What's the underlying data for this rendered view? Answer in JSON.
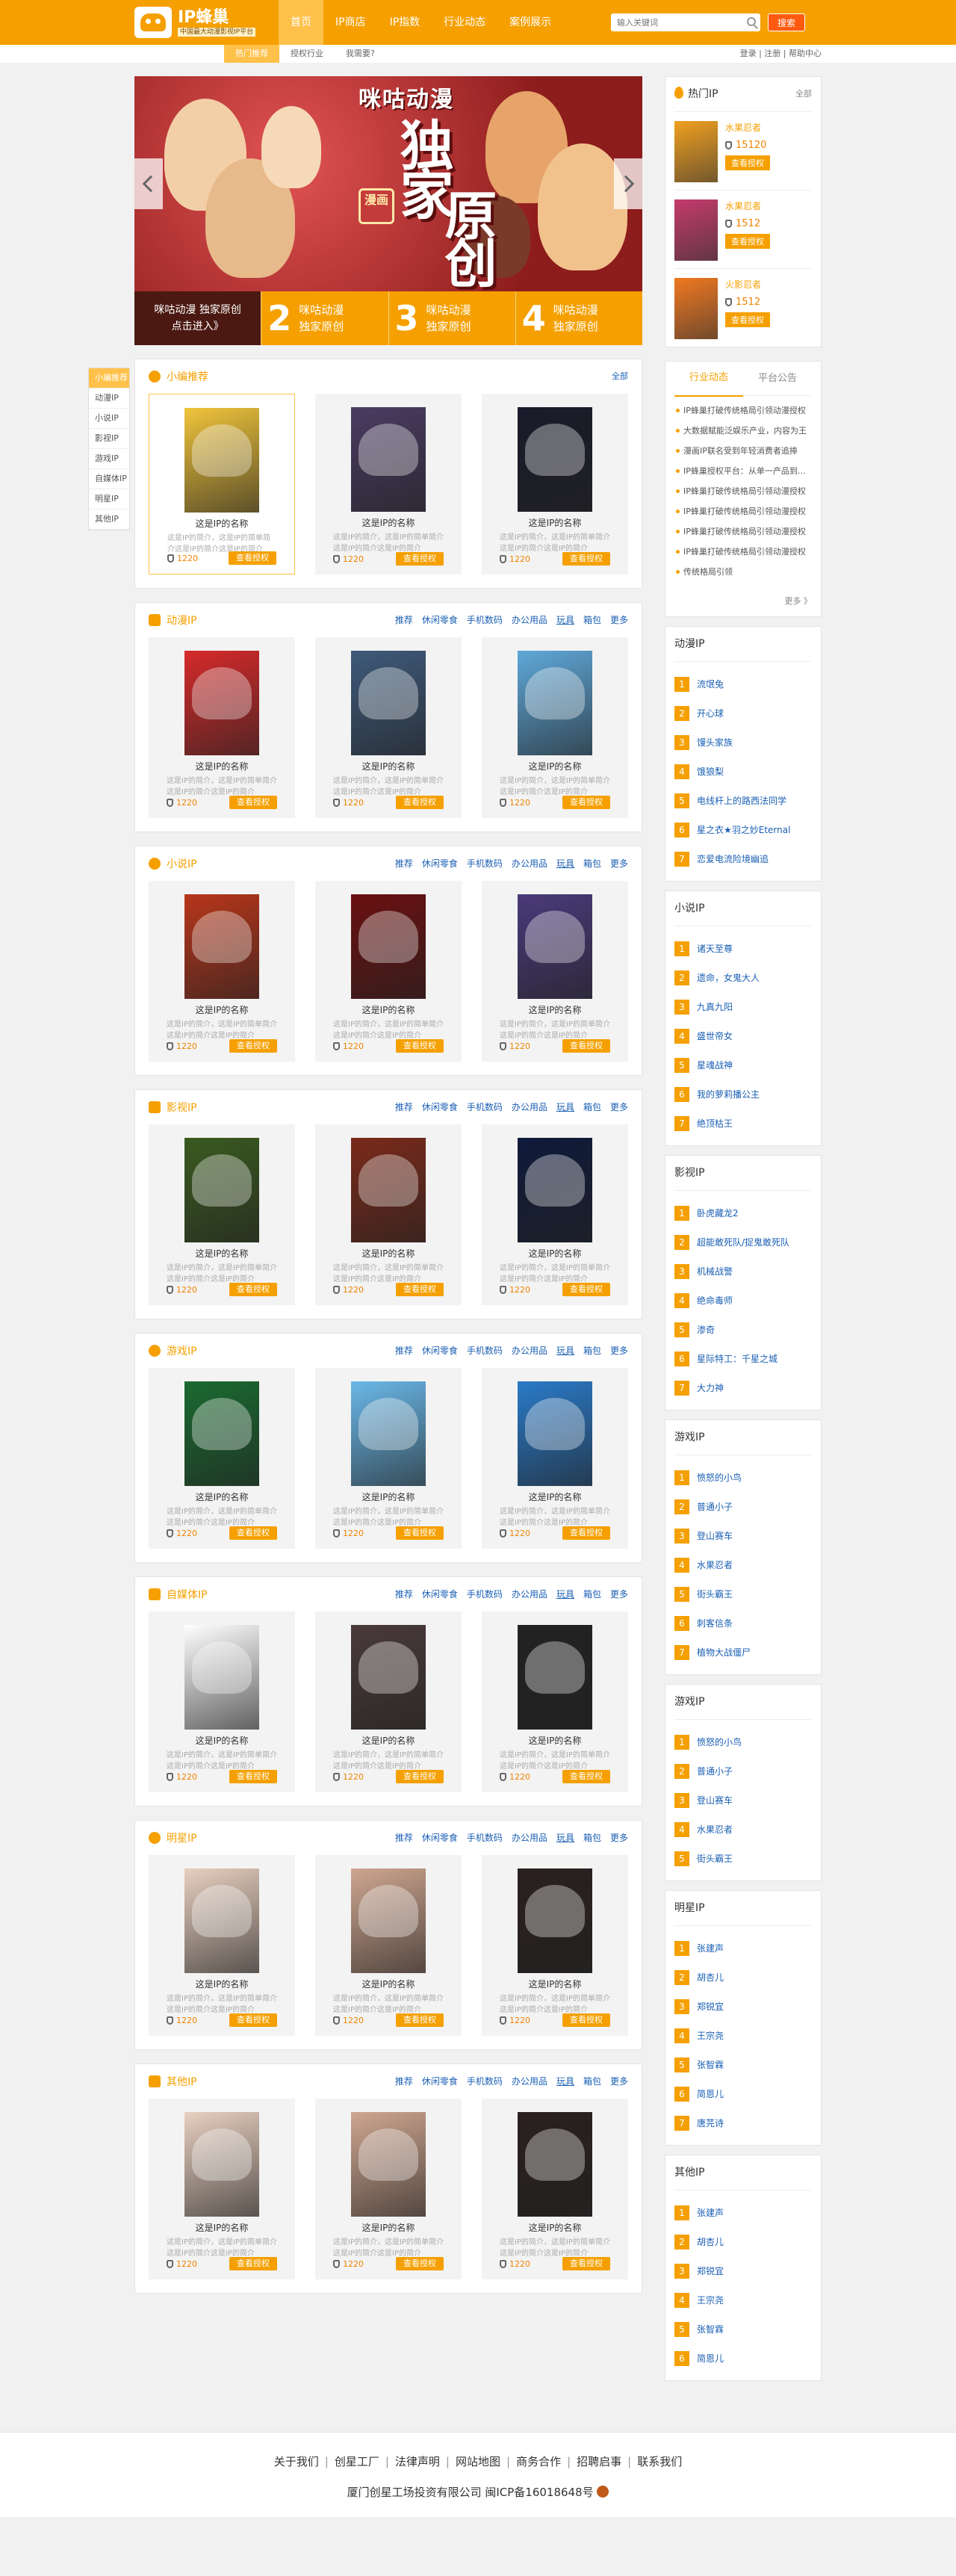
{
  "header": {
    "logo_title": "IP蜂巢",
    "logo_subtitle": "中国最大动漫影视IP平台",
    "nav": [
      {
        "label": "首页",
        "active": true
      },
      {
        "label": "IP商店",
        "active": false
      },
      {
        "label": "IP指数",
        "active": false
      },
      {
        "label": "行业动态",
        "active": false
      },
      {
        "label": "案例展示",
        "active": false
      }
    ],
    "search_placeholder": "输入关键词",
    "search_button": "搜索",
    "accent": "#f5a000"
  },
  "subbar": {
    "tabs": [
      "热门推荐",
      "授权行业",
      "我需要?"
    ],
    "account": "登录 | 注册 | 帮助中心"
  },
  "banner": {
    "brand": "咪咕动漫",
    "headline_a": "独家",
    "headline_b": "原创",
    "seal": "漫画",
    "slides": [
      {
        "text": "咪咕动漫 独家原创\n点击进入》"
      },
      {
        "num": "2",
        "text": "咪咕动漫\n独家原创"
      },
      {
        "num": "3",
        "text": "咪咕动漫\n独家原创"
      },
      {
        "num": "4",
        "text": "咪咕动漫\n独家原创"
      }
    ]
  },
  "cattabs": [
    "小编推荐",
    "动漫IP",
    "小说IP",
    "影视IP",
    "游戏IP",
    "自媒体IP",
    "明星IP",
    "其他IP"
  ],
  "card_common": {
    "name": "这是IP的名称",
    "desc": "这是IP的简介，这是IP的简单简介这是IP的简介这是IP的简介",
    "heat": "1220",
    "button": "查看授权"
  },
  "cat_links": [
    "推荐",
    "休闲零食",
    "手机数码",
    "办公用品",
    "玩具",
    "箱包",
    "更多"
  ],
  "sections": [
    {
      "title": "小编推荐",
      "all": "全部",
      "covers": [
        "#f0c43b",
        "#4a3c62",
        "#1a1a2a"
      ]
    },
    {
      "title": "动漫IP",
      "covers": [
        "#d62a2a",
        "#3f5a7a",
        "#5fa8d9"
      ]
    },
    {
      "title": "小说IP",
      "covers": [
        "#b8361a",
        "#6a1010",
        "#4a3a7a"
      ]
    },
    {
      "title": "影视IP",
      "covers": [
        "#3a5a20",
        "#7a2a1a",
        "#0f1a3a"
      ]
    },
    {
      "title": "游戏IP",
      "covers": [
        "#1a6a30",
        "#6ab8e8",
        "#2a7ac8"
      ]
    },
    {
      "title": "自媒体IP",
      "covers": [
        "#ffffff",
        "#4a3a3a",
        "#222222"
      ]
    },
    {
      "title": "明星IP",
      "covers": [
        "#e8d0c0",
        "#cfa690",
        "#2a2020"
      ]
    },
    {
      "title": "其他IP",
      "covers": [
        "#e8d0c0",
        "#cfa690",
        "#2a2020"
      ]
    }
  ],
  "hot": {
    "title": "热门IP",
    "more": "全部",
    "items": [
      {
        "name": "水果忍者",
        "heat": "15120",
        "button": "查看授权",
        "color": "#f0a020"
      },
      {
        "name": "水果忍者",
        "heat": "1512",
        "button": "查看授权",
        "color": "#c43b6b"
      },
      {
        "name": "火影忍者",
        "heat": "1512",
        "button": "查看授权",
        "color": "#f07820"
      }
    ]
  },
  "news": {
    "tabs": [
      "行业动态",
      "平台公告"
    ],
    "items": [
      "IP蜂巢打破传统格局引领动漫授权",
      "大数据赋能泛娱乐产业，内容为王",
      "漫画IP联名受到年轻消费者追捧",
      "IP蜂巢授权平台：从单一产品到全链路",
      "IP蜂巢打破传统格局引领动漫授权",
      "IP蜂巢打破传统格局引领动漫授权",
      "IP蜂巢打破传统格局引领动漫授权",
      "IP蜂巢打破传统格局引领动漫授权",
      "传统格局引领"
    ],
    "more": "更多 》"
  },
  "ranks": [
    {
      "title": "动漫IP",
      "items": [
        "流氓兔",
        "开心球",
        "馒头家族",
        "饿狼梨",
        "电线杆上的路西法同学",
        "星之衣★羽之妙Eternal",
        "恋爱电流险境幽追"
      ]
    },
    {
      "title": "小说IP",
      "items": [
        "诸天至尊",
        "遗命，女鬼大人",
        "九真九阳",
        "盛世帝女",
        "星魂战神",
        "我的萝莉播公主",
        "绝顶枯王"
      ]
    },
    {
      "title": "影视IP",
      "items": [
        "卧虎藏龙2",
        "超能敢死队/捉鬼敢死队",
        "机械战警",
        "绝命毒师",
        "渗奇",
        "星际特工：千星之城",
        "大力神"
      ]
    },
    {
      "title": "游戏IP",
      "items": [
        "愤怒的小鸟",
        "普通小子",
        "登山赛车",
        "水果忍者",
        "街头霸王",
        "刺客信条",
        "植物大战僵尸"
      ]
    },
    {
      "title": "游戏IP",
      "items": [
        "愤怒的小鸟",
        "普通小子",
        "登山赛车",
        "水果忍者",
        "街头霸王"
      ]
    },
    {
      "title": "明星IP",
      "items": [
        "张建声",
        "胡杏儿",
        "郑锐宜",
        "王宗尧",
        "张智霖",
        "简恩儿",
        "唐芫诗"
      ]
    },
    {
      "title": "其他IP",
      "items": [
        "张建声",
        "胡杏儿",
        "郑锐宜",
        "王宗尧",
        "张智霖",
        "简恩儿"
      ]
    }
  ],
  "footer": {
    "links": [
      "关于我们",
      "创星工厂",
      "法律声明",
      "网站地图",
      "商务合作",
      "招聘启事",
      "联系我们"
    ],
    "copyright": "厦门创星工场投资有限公司  闽ICP备16018648号"
  }
}
